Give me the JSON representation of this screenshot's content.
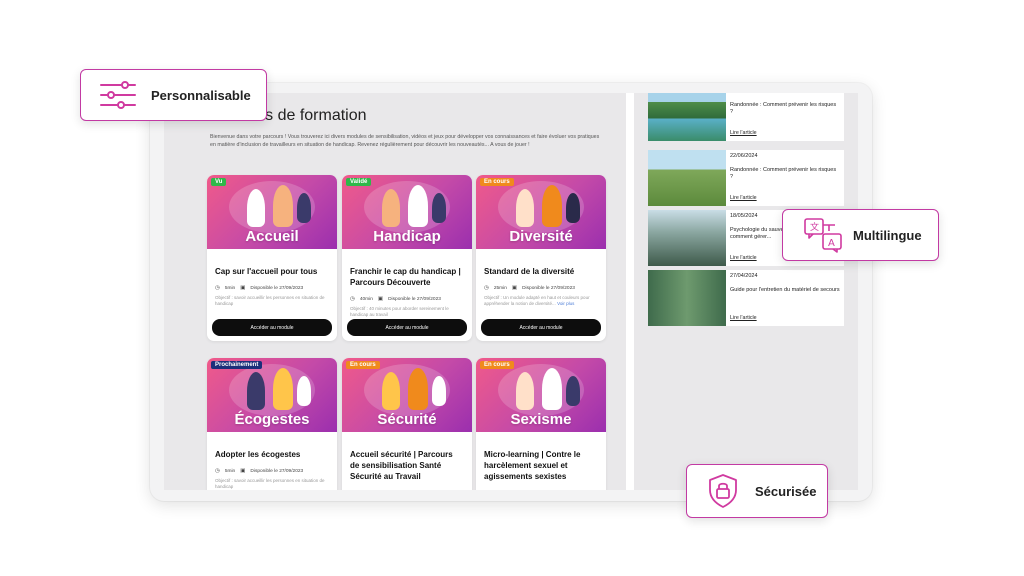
{
  "main": {
    "title": "Parcours de formation",
    "title_visible_part": "cours de formation",
    "intro": "Bienvenue dans votre parcours ! Vous trouverez ici divers modules de sensibilisation, vidéos et jeux pour développer vos connaissances et faire évoluer vos pratiques en matière d'inclusion de travailleurs en situation de handicap. Revenez régulièrement pour découvrir les nouveautés... A vous de jouer !"
  },
  "modules": [
    {
      "badge": "Vu",
      "badge_color": "#2fb84a",
      "image_label": "Accueil",
      "title": "Cap sur l'accueil pour tous",
      "duration": "5min",
      "date": "Disponible le 27/09/2023",
      "objective": "Objectif : savoir accueillir les personnes en situation de handicap",
      "more": "",
      "button": "Accéder au module"
    },
    {
      "badge": "Validé",
      "badge_color": "#2fb84a",
      "image_label": "Handicap",
      "title": "Franchir le cap du handicap | Parcours Découverte",
      "duration": "40min",
      "date": "Disponible le 27/09/2023",
      "objective": "Objectif : 40 minutes pour aborder sereinement le handicap au travail",
      "more": "",
      "button": "Accéder au module"
    },
    {
      "badge": "En cours",
      "badge_color": "#f08a1c",
      "image_label": "Diversité",
      "title": "Standard de la diversité",
      "duration": "25min",
      "date": "Disponible le 27/09/2023",
      "objective": "Objectif : Un module adapté en haut et couleurs pour appréhender la notion de diversité...",
      "more": "Voir plus",
      "button": "Accéder au module"
    },
    {
      "badge": "Prochainement",
      "badge_color": "#1b2f7a",
      "image_label": "Écogestes",
      "title": "Adopter les écogestes",
      "duration": "5min",
      "date": "Disponible le 27/09/2023",
      "objective": "Objectif : savoir accueillir les personnes en situation de handicap",
      "more": "",
      "button": ""
    },
    {
      "badge": "En cours",
      "badge_color": "#f08a1c",
      "image_label": "Sécurité",
      "title": "Accueil sécurité | Parcours de sensibilisation Santé Sécurité au Travail",
      "duration": "",
      "date": "",
      "objective": "",
      "more": "",
      "button": ""
    },
    {
      "badge": "En cours",
      "badge_color": "#f08a1c",
      "image_label": "Sexisme",
      "title": "Micro-learning | Contre le harcèlement sexuel et agissements sexistes",
      "duration": "",
      "date": "",
      "objective": "",
      "more": "",
      "button": ""
    }
  ],
  "articles": [
    {
      "date": "12/07/2024",
      "title": "Randonnée : Comment prévenir les risques ?",
      "link": "Lire l'article",
      "scene": "lake"
    },
    {
      "date": "22/06/2024",
      "title": "Randonnée : Comment prévenir les risques ?",
      "link": "Lire l'article",
      "scene": "chalet"
    },
    {
      "date": "18/05/2024",
      "title": "Psychologie du sauveteur en montagne : comment gérer...",
      "link": "Lire l'article",
      "scene": "group"
    },
    {
      "date": "27/04/2024",
      "title": "Guide pour l'entretien du matériel de secours",
      "link": "Lire l'article",
      "scene": "gear"
    }
  ],
  "features": {
    "custom": {
      "label": "Personnalisable",
      "icon": "sliders-icon"
    },
    "multi": {
      "label": "Multilingue",
      "icon": "translate-icon"
    },
    "secure": {
      "label": "Sécurisée",
      "icon": "shield-icon"
    }
  },
  "colors": {
    "accent": "#c23aa3",
    "card_gradient_start": "#f05a8a",
    "card_gradient_end": "#9b2fae",
    "button": "#0d0d0d"
  }
}
